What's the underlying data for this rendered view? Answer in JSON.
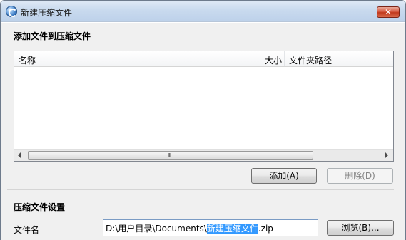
{
  "window": {
    "title": "新建压缩文件",
    "close_label": "✕"
  },
  "add_section": {
    "heading": "添加文件到压缩文件",
    "columns": [
      "名称",
      "大小",
      "文件夹路径"
    ],
    "scroll_grip": "III",
    "add_button": "添加(A)",
    "delete_button": "删除(D)"
  },
  "settings_section": {
    "heading": "压缩文件设置",
    "filename_label": "文件名",
    "filename_prefix": "D:\\用户目录\\Documents\\",
    "filename_selected": "新建压缩文件",
    "filename_suffix": ".zip",
    "browse_button": "浏览(B)..."
  }
}
